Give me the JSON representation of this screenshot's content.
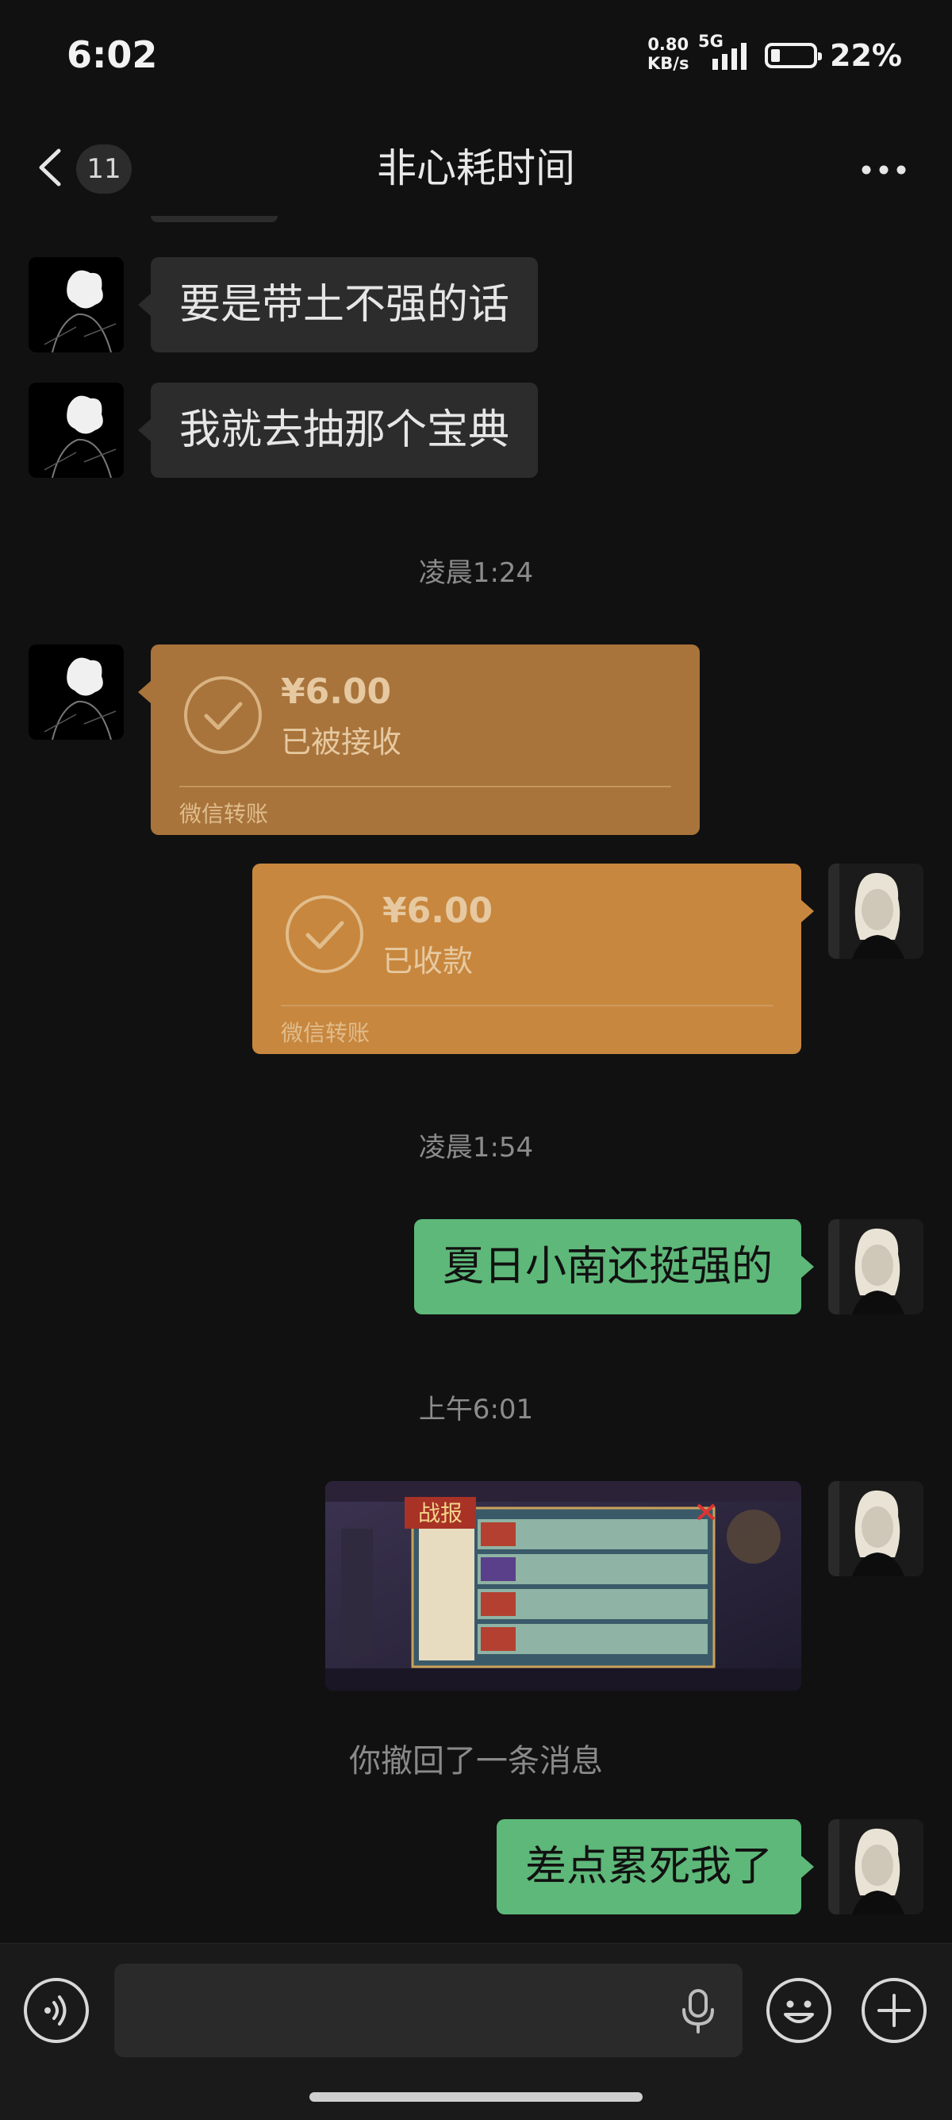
{
  "status_bar": {
    "time": "6:02",
    "speed_value": "0.80",
    "speed_unit": "KB/s",
    "network": "5G",
    "battery_pct": "22%",
    "battery_level": 0.22
  },
  "nav": {
    "unread_count": "11",
    "title": "非心耗时间"
  },
  "messages": {
    "m1": "要是带土不强的话",
    "m2": "我就去抽那个宝典",
    "sep1": "凌晨1:24",
    "transfer_in": {
      "amount": "¥6.00",
      "status": "已被接收",
      "brand": "微信转账"
    },
    "transfer_out": {
      "amount": "¥6.00",
      "status": "已收款",
      "brand": "微信转账"
    },
    "sep2": "凌晨1:54",
    "m3": "夏日小南还挺强的",
    "sep3": "上午6:01",
    "image_badge": "战报",
    "recall": "你撤回了一条消息",
    "m4": "差点累死我了"
  },
  "colors": {
    "background": "#111111",
    "gray_bubble": "#2c2c2c",
    "green_bubble": "#5eb879",
    "transfer_received": "#a8743b",
    "transfer_sent": "#c8873e"
  },
  "icons": {
    "back": "chevron-left-icon",
    "more": "ellipsis-icon",
    "voice": "voice-icon",
    "mic": "microphone-icon",
    "emoji": "emoji-icon",
    "plus": "plus-icon",
    "check": "check-circle-icon"
  }
}
